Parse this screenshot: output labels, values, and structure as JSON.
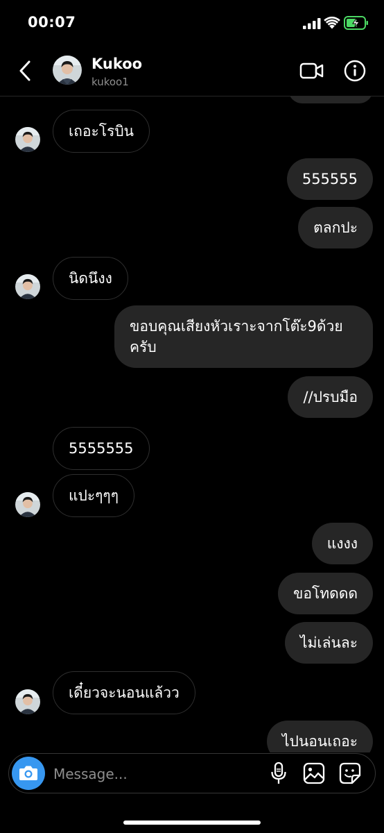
{
  "status_bar": {
    "time": "00:07"
  },
  "header": {
    "name": "Kukoo",
    "handle": "kukoo1"
  },
  "messages": [
    {
      "text": "เถอะโรบิน",
      "direction": "in"
    },
    {
      "text": "555555",
      "direction": "out"
    },
    {
      "text": "ตลกปะ",
      "direction": "out"
    },
    {
      "text": "นิดนึงง",
      "direction": "in"
    },
    {
      "text_line1": "ขอบคุณเสียงหัวเราะจากโต๊ะ9ด้วย",
      "text_line2": "ครับ",
      "direction": "out"
    },
    {
      "text": "//ปรบมือ",
      "direction": "out"
    },
    {
      "text": "5555555",
      "direction": "in"
    },
    {
      "text": "แปะๆๆๆ",
      "direction": "in"
    },
    {
      "text": "แงงง",
      "direction": "out"
    },
    {
      "text": "ขอโทดดด",
      "direction": "out"
    },
    {
      "text": "ไม่เล่นละ",
      "direction": "out"
    },
    {
      "text": "เดี๋ยวจะนอนแล้วว",
      "direction": "in"
    },
    {
      "text": "ไปนอนเถอะ",
      "direction": "out"
    }
  ],
  "composer": {
    "placeholder": "Message..."
  },
  "icons": {
    "back": "chevron-left-icon",
    "video": "video-camera-icon",
    "info": "info-icon",
    "camera": "camera-icon",
    "mic": "microphone-icon",
    "gallery": "image-icon",
    "sticker": "sticker-icon"
  },
  "colors": {
    "background": "#000000",
    "outgoing_bubble": "#262626",
    "incoming_border": "#2f2f2f",
    "accent": "#3797f0",
    "battery_charging": "#4cd964"
  }
}
